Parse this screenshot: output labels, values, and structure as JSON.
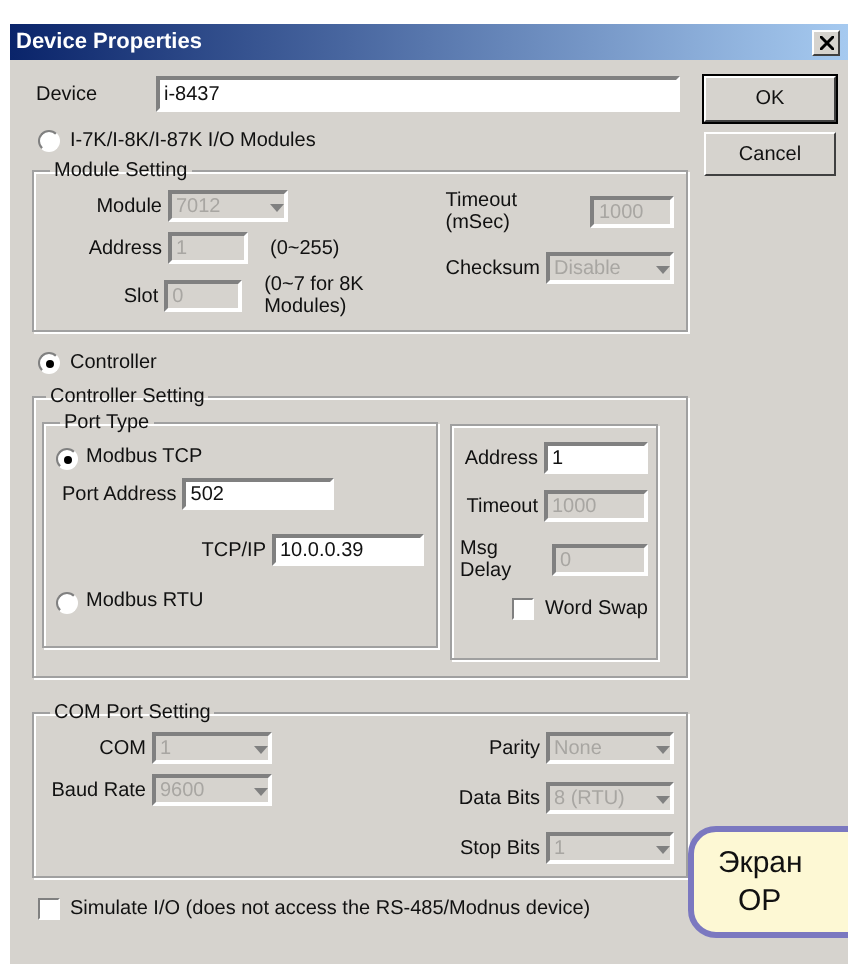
{
  "window": {
    "title": "Device Properties"
  },
  "device": {
    "label": "Device",
    "value": "i-8437"
  },
  "buttons": [
    {
      "label": "OK",
      "default": true
    },
    {
      "label": "Cancel",
      "default": false
    }
  ],
  "module_mode": {
    "label": "I-7K/I-8K/I-87K I/O Modules",
    "selected": false
  },
  "module_setting": {
    "title": "Module Setting",
    "left": [
      {
        "kind": "dropdown",
        "label": "Module",
        "value": "7012",
        "disabled": true
      },
      {
        "kind": "text",
        "label": "Address",
        "value": "1",
        "hint": "(0~255)",
        "disabled": true
      },
      {
        "kind": "text",
        "label": "Slot",
        "value": "0",
        "hint": "(0~7 for 8K Modules)",
        "disabled": true
      }
    ],
    "right": [
      {
        "kind": "text",
        "label": "Timeout (mSec)",
        "value": "1000",
        "disabled": true
      },
      {
        "kind": "dropdown",
        "label": "Checksum",
        "value": "Disable",
        "disabled": true
      }
    ]
  },
  "controller_mode": {
    "label": "Controller",
    "selected": true
  },
  "controller_setting": {
    "title": "Controller Setting",
    "port_type": {
      "title": "Port Type",
      "options": [
        {
          "label": "Modbus TCP",
          "selected": true
        },
        {
          "label": "Modbus RTU",
          "selected": false
        }
      ],
      "fields": [
        {
          "kind": "text",
          "label": "Port Address",
          "value": "502",
          "disabled": false
        },
        {
          "kind": "text",
          "label": "TCP/IP",
          "value": "10.0.0.39",
          "disabled": false
        }
      ]
    },
    "fields": [
      {
        "kind": "text",
        "label": "Address",
        "value": "1",
        "disabled": false
      },
      {
        "kind": "text",
        "label": "Timeout",
        "value": "1000",
        "disabled": true
      },
      {
        "kind": "text",
        "label": "Msg Delay",
        "value": "0",
        "disabled": true
      }
    ],
    "word_swap": {
      "label": "Word Swap",
      "checked": false
    }
  },
  "com_port_setting": {
    "title": "COM Port Setting",
    "left": [
      {
        "kind": "dropdown",
        "label": "COM",
        "value": "1",
        "disabled": true
      },
      {
        "kind": "dropdown",
        "label": "Baud Rate",
        "value": "9600",
        "disabled": true
      }
    ],
    "right": [
      {
        "kind": "dropdown",
        "label": "Parity",
        "value": "None",
        "disabled": true
      },
      {
        "kind": "dropdown",
        "label": "Data Bits",
        "value": "8 (RTU)",
        "disabled": true
      },
      {
        "kind": "dropdown",
        "label": "Stop Bits",
        "value": "1",
        "disabled": true
      }
    ]
  },
  "simulate": {
    "label": "Simulate I/O (does not access the RS-485/Modnus device)",
    "checked": false
  },
  "callout": {
    "lines": [
      "Экран",
      "OP"
    ]
  }
}
